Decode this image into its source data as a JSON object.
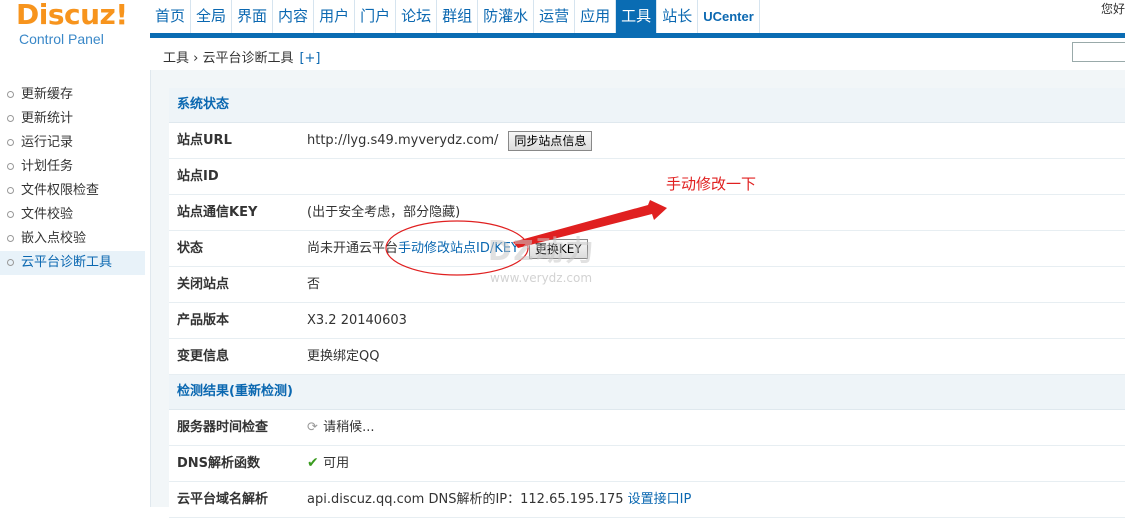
{
  "logo": {
    "brand": "Discuz",
    "bang": "!",
    "subtitle": "Control Panel"
  },
  "nav": {
    "items": [
      "首页",
      "全局",
      "界面",
      "内容",
      "用户",
      "门户",
      "论坛",
      "群组",
      "防灌水",
      "运营",
      "应用",
      "工具",
      "站长",
      "UCenter"
    ],
    "active": "工具"
  },
  "user_greeting": "您好",
  "breadcrumb": {
    "path": "工具 › 云平台诊断工具",
    "add": "[+]"
  },
  "sidebar": {
    "items": [
      {
        "label": "更新缓存"
      },
      {
        "label": "更新统计"
      },
      {
        "label": "运行记录"
      },
      {
        "label": "计划任务"
      },
      {
        "label": "文件权限检查"
      },
      {
        "label": "文件校验"
      },
      {
        "label": "嵌入点校验"
      },
      {
        "label": "云平台诊断工具",
        "active": true
      }
    ]
  },
  "system_status": {
    "title": "系统状态",
    "site_url_label": "站点URL",
    "site_url_value": "http://lyg.s49.myverydz.com/",
    "sync_button": "同步站点信息",
    "site_id_label": "站点ID",
    "site_key_label": "站点通信KEY",
    "site_key_value": "(出于安全考虑，部分隐藏)",
    "status_label": "状态",
    "status_text": "尚未开通云平台",
    "manual_link": "手动修改站点ID/KEY",
    "key_button": "更换KEY",
    "closed_label": "关闭站点",
    "closed_value": "否",
    "version_label": "产品版本",
    "version_value": "X3.2 20140603",
    "change_label": "变更信息",
    "change_link": "更换绑定QQ"
  },
  "check_results": {
    "title": "检测结果(重新检测)",
    "server_time_label": "服务器时间检查",
    "server_time_value": "请稍候...",
    "dns_label": "DNS解析函数",
    "dns_value": "可用",
    "cloud_dns_label": "云平台域名解析",
    "cloud_dns_value": "api.discuz.qq.com DNS解析的IP：112.65.195.175",
    "set_ip_link": "设置接口IP"
  },
  "annotation": {
    "text": "手动修改一下"
  },
  "watermark": {
    "text": "DZ动力",
    "sub": "www.verydz.com"
  },
  "colors": {
    "nav_active": "#0a6cb3",
    "link": "#0b68b1",
    "annotation": "#e02020",
    "logo": "#f7941d"
  }
}
